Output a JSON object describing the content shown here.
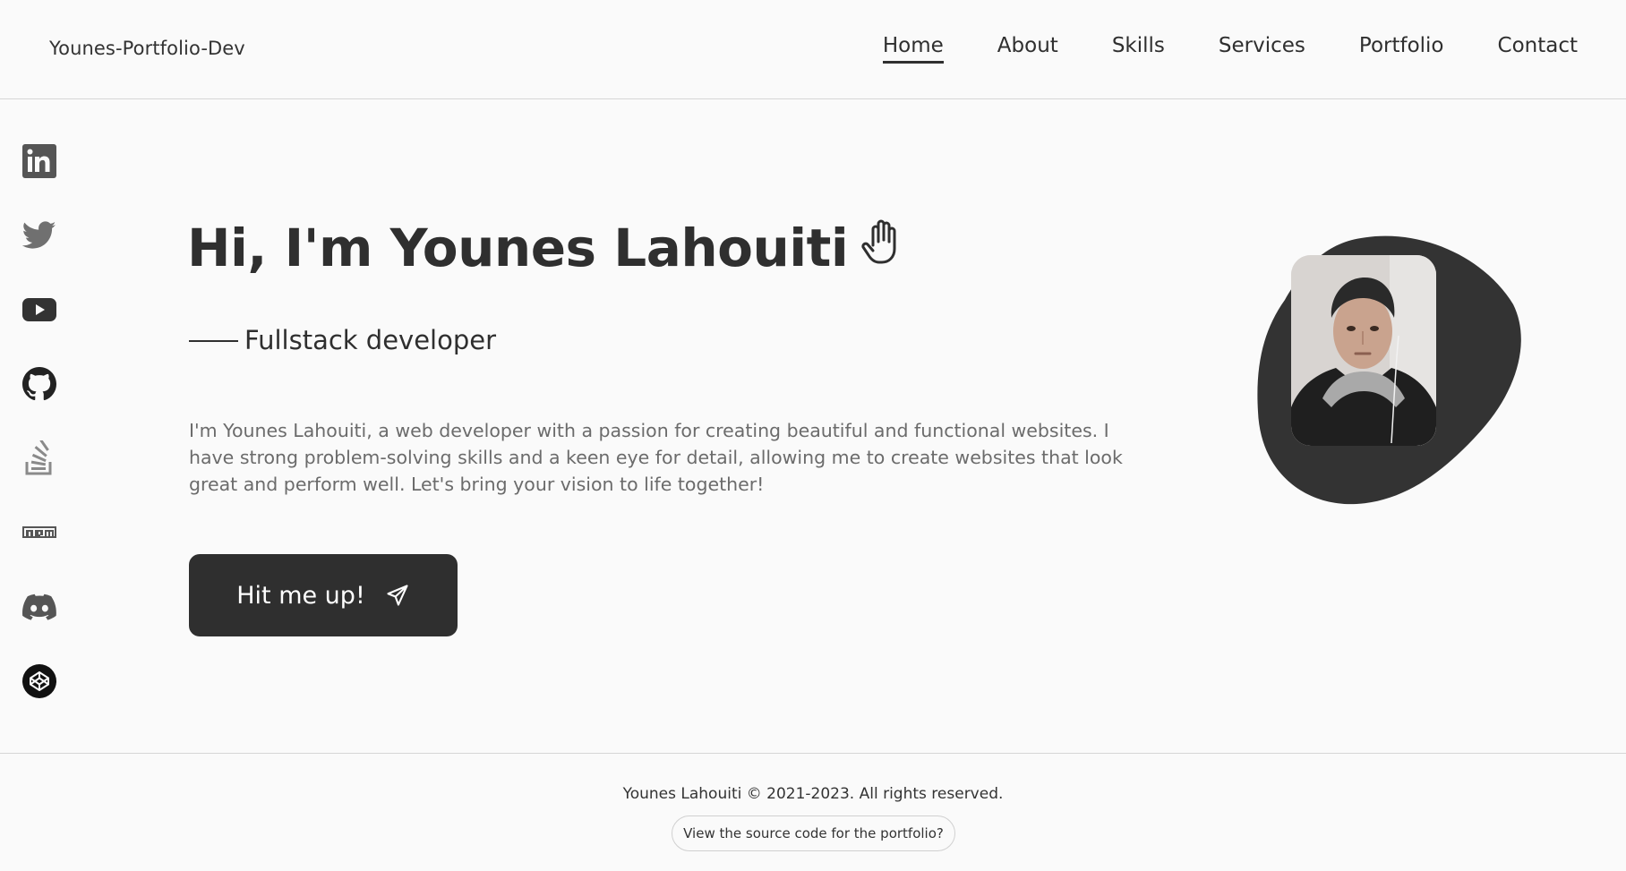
{
  "header": {
    "brand": "Younes-Portfolio-Dev",
    "nav": [
      {
        "label": "Home",
        "active": true
      },
      {
        "label": "About"
      },
      {
        "label": "Skills"
      },
      {
        "label": "Services"
      },
      {
        "label": "Portfolio"
      },
      {
        "label": "Contact"
      }
    ]
  },
  "social": [
    {
      "icon": "linkedin-icon"
    },
    {
      "icon": "twitter-icon"
    },
    {
      "icon": "youtube-icon"
    },
    {
      "icon": "github-icon"
    },
    {
      "icon": "stackoverflow-icon"
    },
    {
      "icon": "npm-icon"
    },
    {
      "icon": "discord-icon"
    },
    {
      "icon": "codepen-icon"
    }
  ],
  "hero": {
    "title": "Hi, I'm Younes Lahouiti",
    "title_icon": "waving-hand-icon",
    "subtitle": "Fullstack developer",
    "description": "I'm Younes Lahouiti, a web developer with a passion for creating beautiful and functional websites. I have strong problem-solving skills and a keen eye for detail, allowing me to create websites that look great and perform well. Let's bring your vision to life together!",
    "cta_label": "Hit me up!",
    "cta_icon": "send-icon"
  },
  "profile": {
    "image": "profile-photo"
  },
  "footer": {
    "copyright": "Younes Lahouiti © 2021-2023. All rights reserved.",
    "source_label": "View the source code for the portfolio?"
  },
  "colors": {
    "background": "#fafafa",
    "primary": "#2f2f2f",
    "text_muted": "#6b6b6b",
    "border": "#d6d6d6"
  }
}
